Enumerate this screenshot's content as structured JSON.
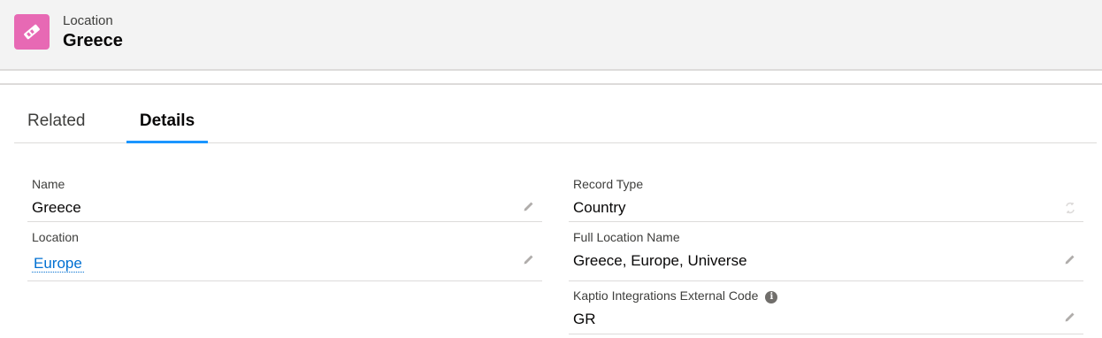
{
  "header": {
    "object_label": "Location",
    "record_title": "Greece",
    "icon": "location-icon",
    "icon_color": "#e769b4"
  },
  "tabs": [
    {
      "label": "Related",
      "active": false
    },
    {
      "label": "Details",
      "active": true
    }
  ],
  "fields": {
    "name": {
      "label": "Name",
      "value": "Greece",
      "icon": "pencil-icon"
    },
    "location": {
      "label": "Location",
      "value": "Europe",
      "icon": "pencil-icon"
    },
    "record_type": {
      "label": "Record Type",
      "value": "Country",
      "icon": "change-record-type-icon"
    },
    "full_location_name": {
      "label": "Full Location Name",
      "value": "Greece, Europe, Universe",
      "icon": "pencil-icon"
    },
    "external_code": {
      "label": "Kaptio Integrations External Code",
      "value": "GR",
      "icon": "pencil-icon",
      "help_icon": "info-icon",
      "help_glyph": "i"
    }
  },
  "colors": {
    "accent": "#1b96ff",
    "link": "#0070d2",
    "header_bg": "#f3f3f3"
  }
}
